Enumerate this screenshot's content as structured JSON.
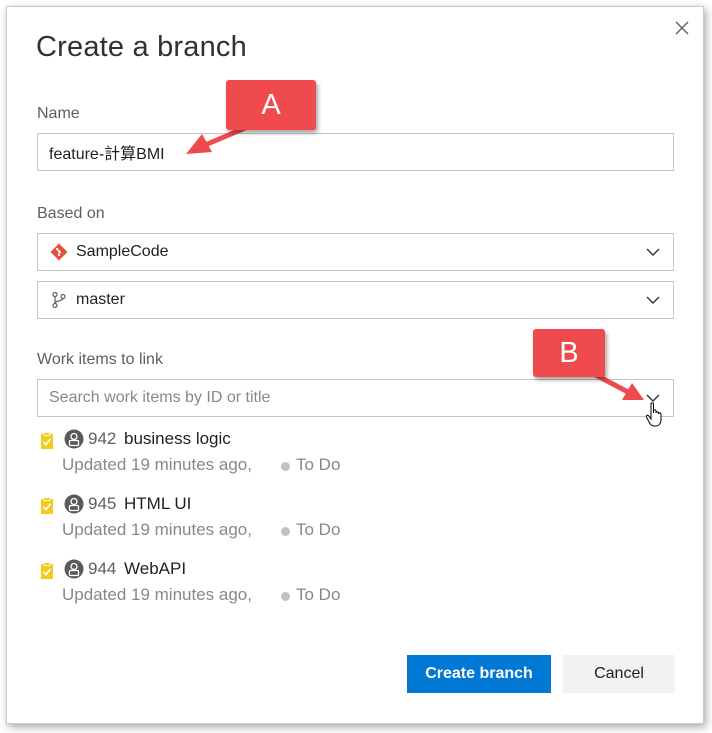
{
  "dialog": {
    "title": "Create a branch",
    "close_icon": "close-icon"
  },
  "name_field": {
    "label": "Name",
    "value": "feature-計算BMI"
  },
  "based_on": {
    "label": "Based on",
    "repository": {
      "icon": "git-repo-icon",
      "value": "SampleCode"
    },
    "branch": {
      "icon": "git-branch-icon",
      "value": "master"
    }
  },
  "work_items": {
    "label": "Work items to link",
    "placeholder": "Search work items by ID or title",
    "items": [
      {
        "id": "942",
        "title": "business logic",
        "updated": "Updated 19 minutes ago,",
        "state": "To Do"
      },
      {
        "id": "945",
        "title": "HTML UI",
        "updated": "Updated 19 minutes ago,",
        "state": "To Do"
      },
      {
        "id": "944",
        "title": "WebAPI",
        "updated": "Updated 19 minutes ago,",
        "state": "To Do"
      }
    ]
  },
  "buttons": {
    "create": "Create branch",
    "cancel": "Cancel"
  },
  "annotations": {
    "a": "A",
    "b": "B"
  },
  "colors": {
    "primary": "#0078d4",
    "callout": "#ef4a4d",
    "task_icon": "#f2cb1d",
    "repo_icon": "#e5533d"
  }
}
